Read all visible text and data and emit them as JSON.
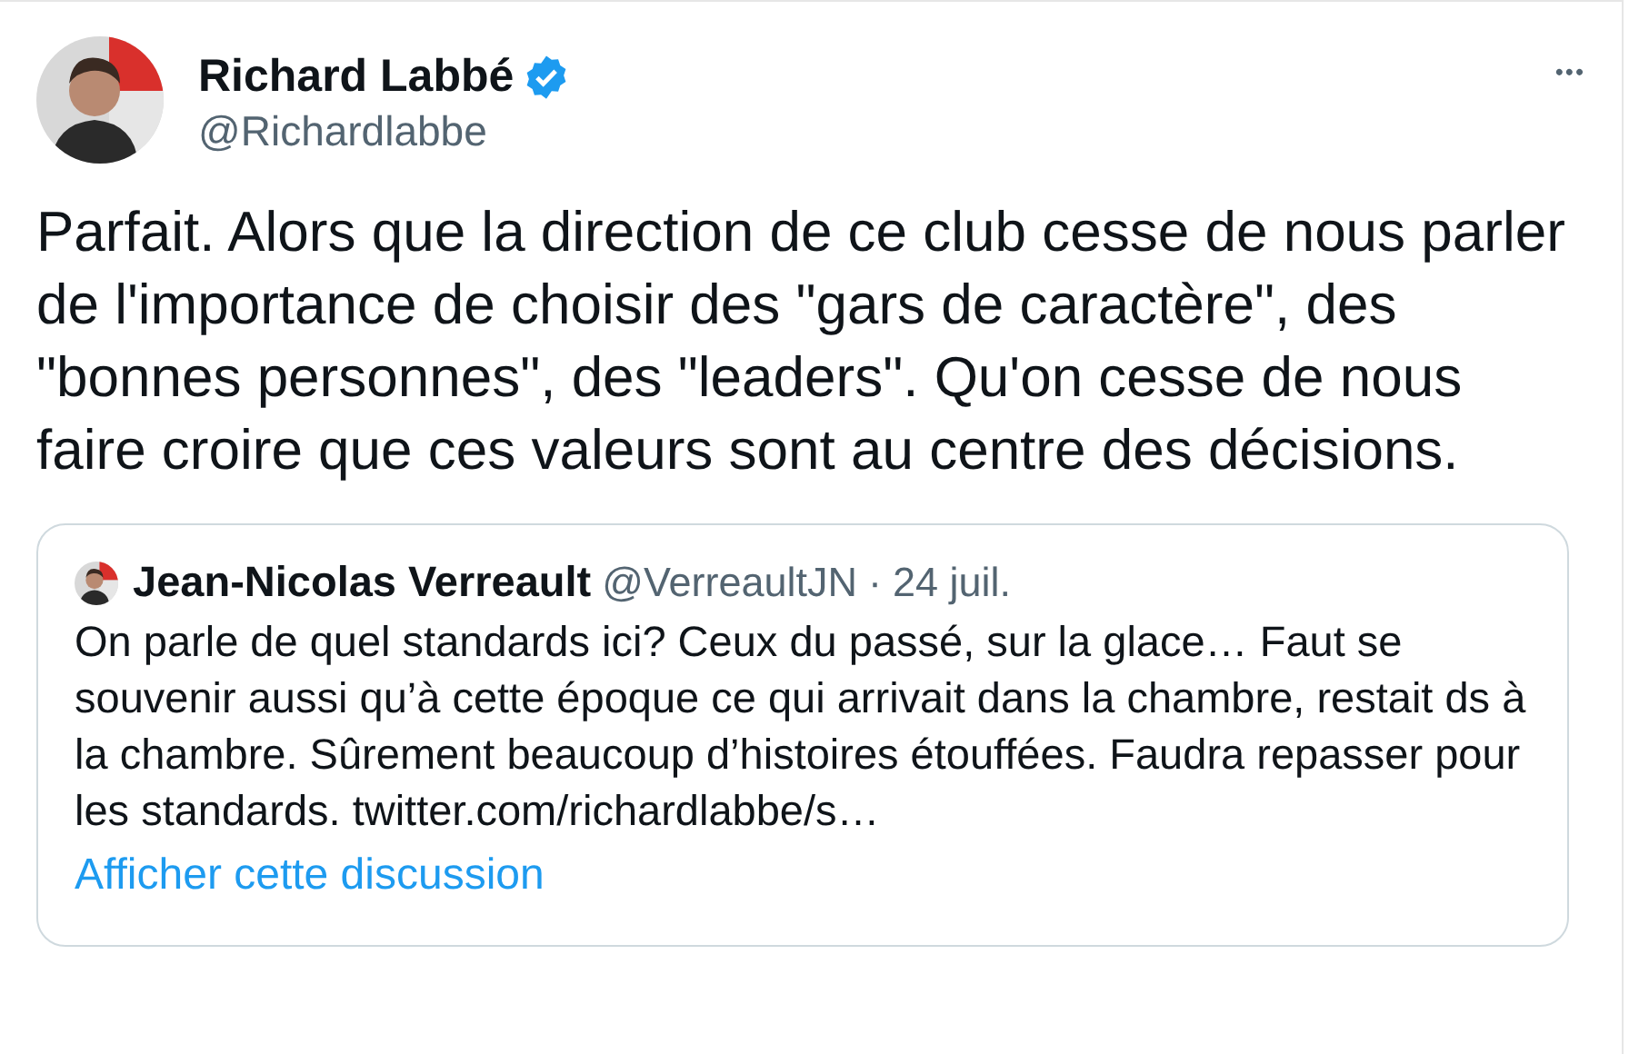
{
  "tweet": {
    "author": {
      "name": "Richard Labbé",
      "handle": "@Richardlabbe",
      "verified": true
    },
    "more_button": "•••",
    "text": "Parfait. Alors que la direction de ce club cesse de nous parler de l'importance de choisir des \"gars de caractère\", des \"bonnes personnes\", des \"leaders\". Qu'on cesse de nous faire croire que ces valeurs sont au centre des décisions.",
    "quoted_tweet": {
      "author": {
        "name": "Jean-Nicolas Verreault",
        "handle": "@VerreaultJN"
      },
      "separator": "·",
      "date": "24 juil.",
      "text": "On parle de quel standards ici? Ceux du passé, sur la glace… Faut se souvenir aussi qu’à cette époque ce qui arrivait dans la chambre, restait ds à la chambre. Sûrement beaucoup d’histoires étouffées. Faudra repasser pour les standards. twitter.com/richardlabbe/s…",
      "show_thread_link": "Afficher cette discussion"
    }
  }
}
